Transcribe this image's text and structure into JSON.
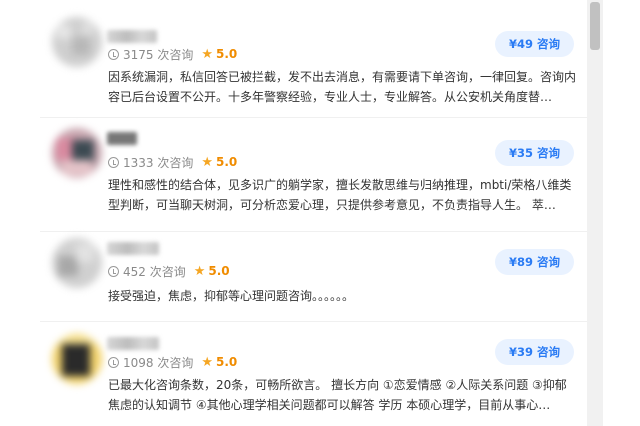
{
  "consultants": [
    {
      "consult_count": "3175 次咨询",
      "rating": "5.0",
      "price_label": "¥49 咨询",
      "description": "因系统漏洞，私信回答已被拦截，发不出去消息，有需要请下单咨询，一律回复。咨询内容已后台设置不公开。十多年警察经验，专业人士，专业解答。从公安机关角度替…"
    },
    {
      "consult_count": "1333 次咨询",
      "rating": "5.0",
      "price_label": "¥35 咨询",
      "description": "理性和感性的结合体，见多识广的躺学家，擅长发散思维与归纳推理，mbti/荣格八维类型判断，可当聊天树洞，可分析恋爱心理，只提供参考意见，不负责指导人生。 萃…"
    },
    {
      "consult_count": "452 次咨询",
      "rating": "5.0",
      "price_label": "¥89 咨询",
      "description": "接受强迫，焦虑，抑郁等心理问题咨询。。。。。。"
    },
    {
      "consult_count": "1098 次咨询",
      "rating": "5.0",
      "price_label": "¥39 咨询",
      "description": "已最大化咨询条数，20条，可畅所欲言。 擅长方向 ①恋爱情感 ②人际关系问题 ③抑郁焦虑的认知调节 ④其他心理学相关问题都可以解答 学历 本硕心理学，目前从事心…"
    }
  ],
  "colors": {
    "accent": "#2a7bf4",
    "button_bg": "#e9f2ff",
    "star": "#f5a623",
    "rating": "#f08c00"
  },
  "icons": [
    "clock-icon",
    "star-icon"
  ]
}
